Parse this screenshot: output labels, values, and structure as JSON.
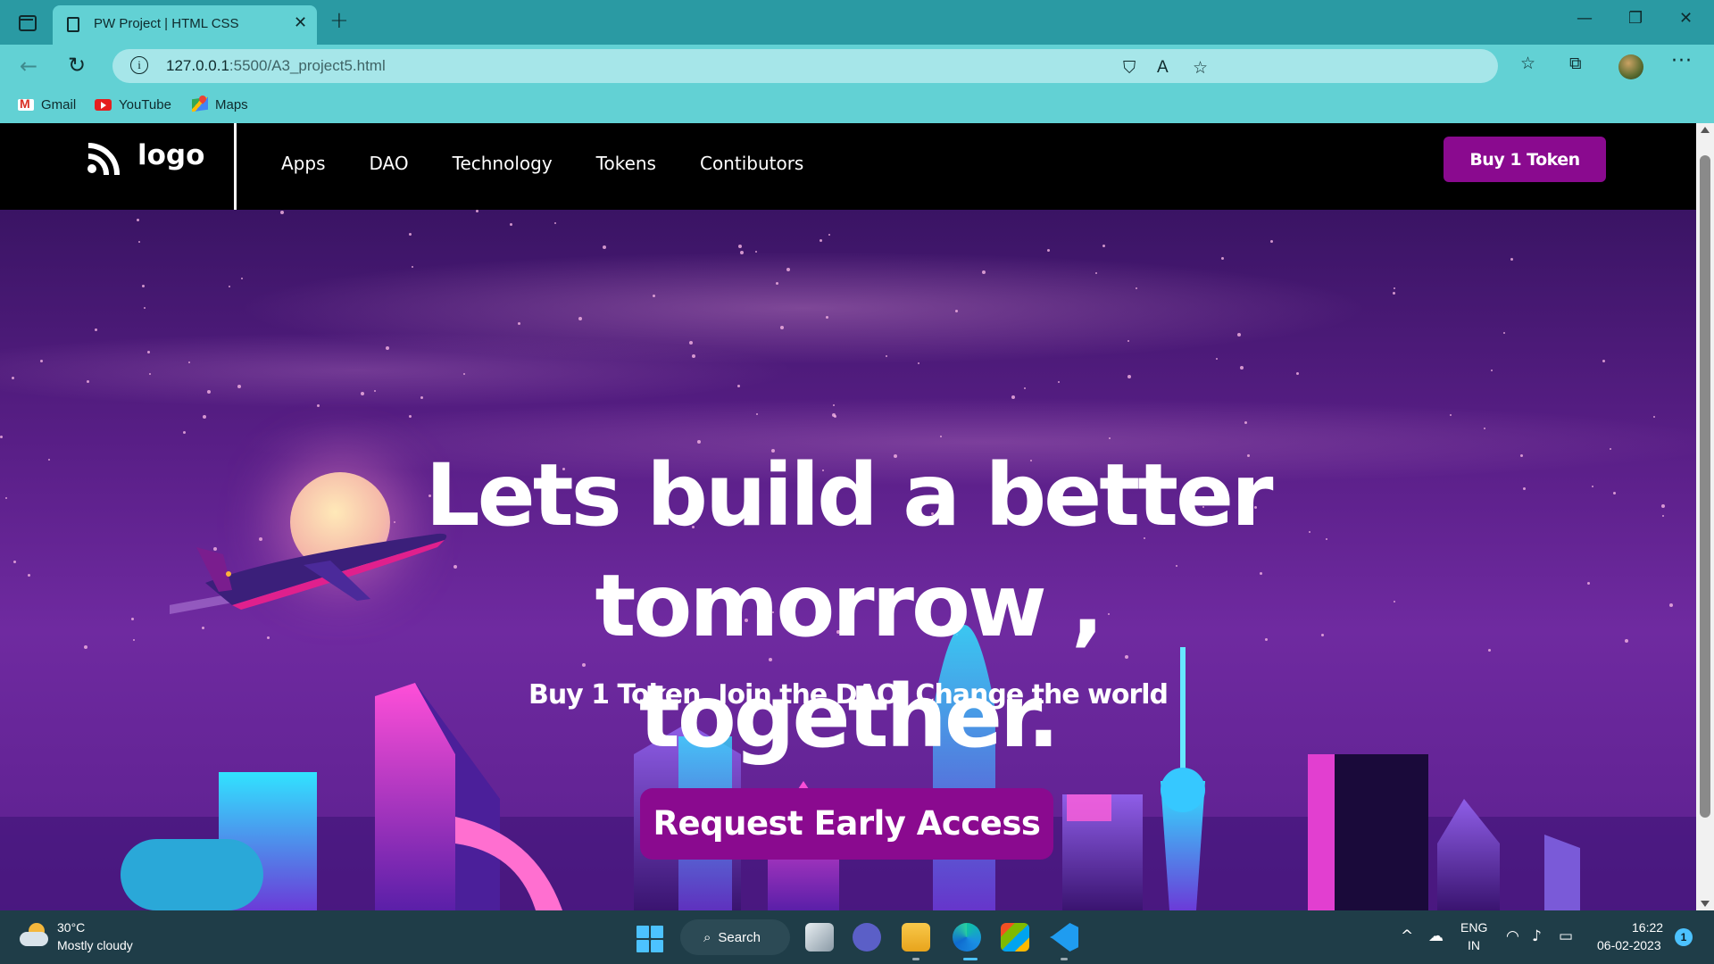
{
  "browser": {
    "tab_title": "PW Project | HTML CSS",
    "tab_close": "✕",
    "new_tab": "+",
    "window_minimize": "—",
    "window_restore": "❐",
    "window_close": "✕",
    "url_host": "127.0.0.1",
    "url_path": ":5500/A3_project5.html",
    "bookmarks": [
      {
        "label": "Gmail"
      },
      {
        "label": "YouTube"
      },
      {
        "label": "Maps"
      }
    ],
    "icons": [
      "sidebar-icon",
      "back-icon",
      "reload-icon",
      "info-icon",
      "tracking-prevention-icon",
      "read-aloud-icon",
      "add-favorite-icon",
      "favorites-icon",
      "collections-icon",
      "profile-avatar",
      "more-icon"
    ]
  },
  "site": {
    "logo_text": "logo",
    "nav_links": [
      "Apps",
      "DAO",
      "Technology",
      "Tokens",
      "Contibutors"
    ],
    "buy_button": "Buy 1 Token",
    "hero_title_line1": "Lets build a better",
    "hero_title_line2": "tomorrow ,",
    "hero_title_line3": "together.",
    "hero_subtitle": "Buy 1 Token. Join the DAO. Change the world",
    "cta_button": "Request Early Access",
    "colors": {
      "accent": "#8a0a8f",
      "nav_bg": "#000000",
      "hero_bg": "#5a1f88"
    }
  },
  "taskbar": {
    "weather_temp": "30°C",
    "weather_desc": "Mostly cloudy",
    "search_label": "Search",
    "lang_line1": "ENG",
    "lang_line2": "IN",
    "time": "16:22",
    "date": "06-02-2023",
    "notification_count": "1",
    "tray_chevron": "^"
  }
}
